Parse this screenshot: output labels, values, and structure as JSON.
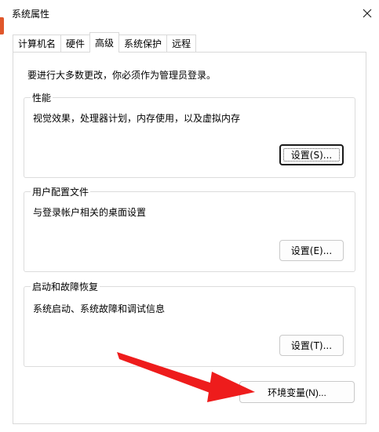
{
  "window": {
    "title": "系统属性",
    "close_glyph": "✕"
  },
  "tabs": [
    {
      "label": "计算机名"
    },
    {
      "label": "硬件"
    },
    {
      "label": "高级",
      "active": true
    },
    {
      "label": "系统保护"
    },
    {
      "label": "远程"
    }
  ],
  "advanced": {
    "admin_note": "要进行大多数更改，你必须作为管理员登录。",
    "performance": {
      "title": "性能",
      "description": "视觉效果，处理器计划，内存使用，以及虚拟内存",
      "button_label": "设置(S)..."
    },
    "user_profiles": {
      "title": "用户配置文件",
      "description": "与登录帐户相关的桌面设置",
      "button_label": "设置(E)..."
    },
    "startup_recovery": {
      "title": "启动和故障恢复",
      "description": "系统启动、系统故障和调试信息",
      "button_label": "设置(T)..."
    },
    "env_button_label": "环境变量(N)..."
  },
  "colors": {
    "annotation_arrow": "#ee1c1c",
    "left_edge_accent": "#e0572b"
  },
  "icons": [
    "close-icon",
    "annotation-arrow"
  ]
}
